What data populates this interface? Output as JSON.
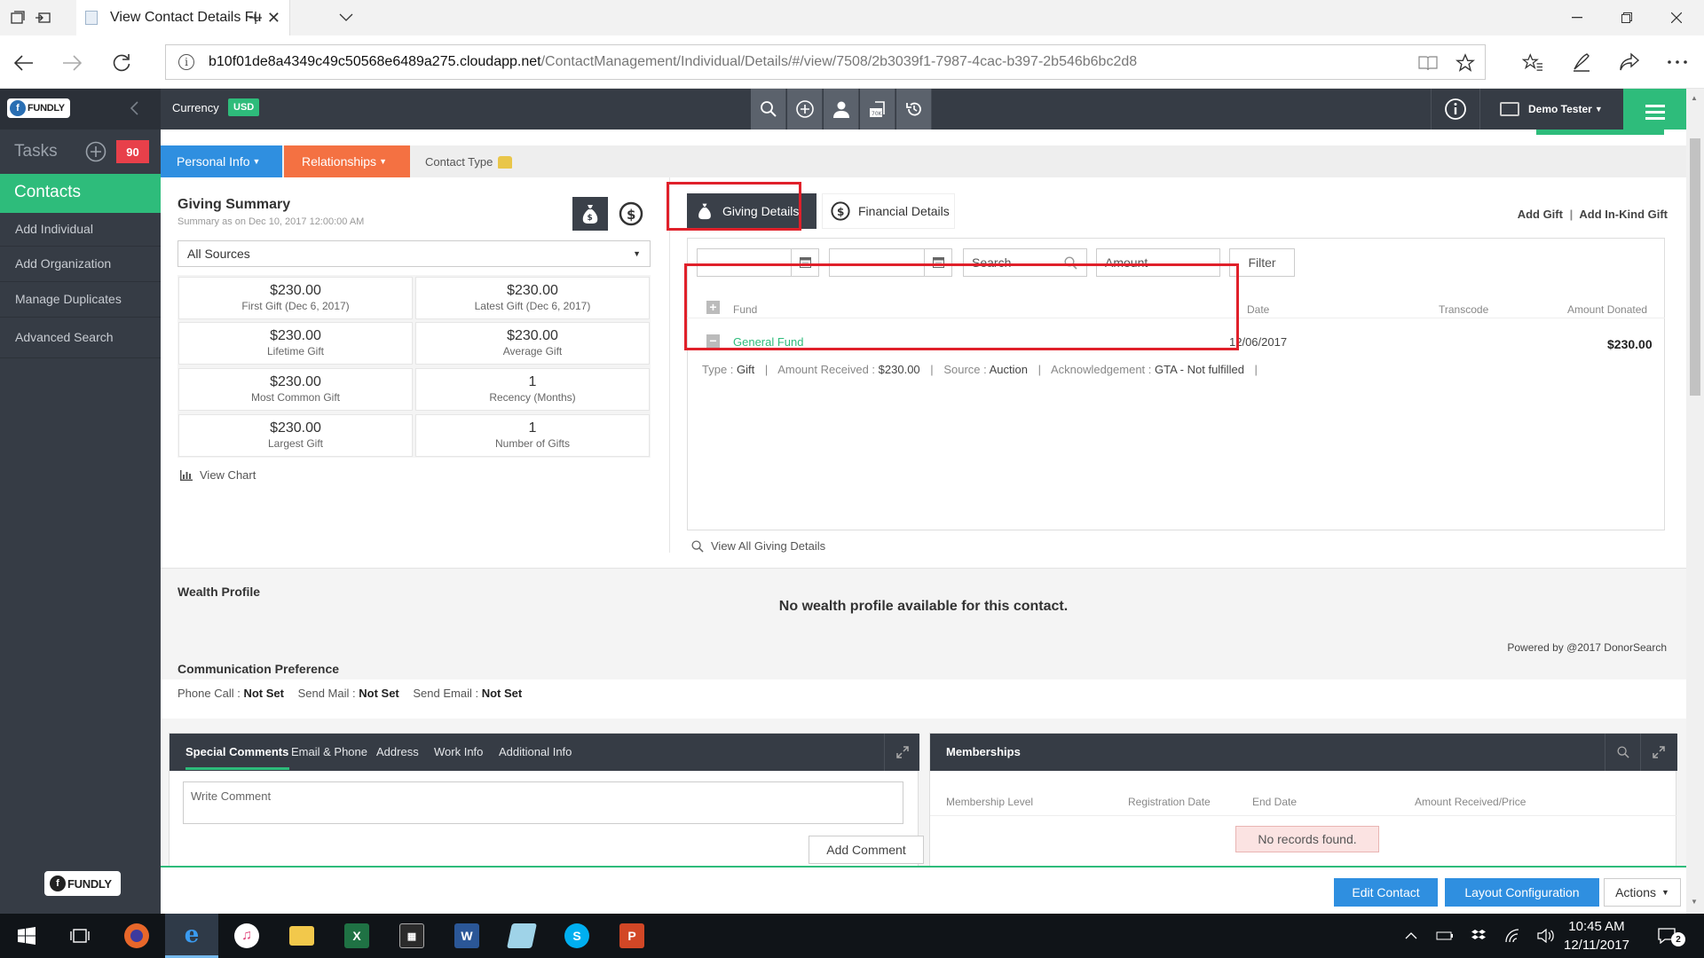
{
  "browser": {
    "tab_title": "View Contact Details Fu",
    "url_host": "b10f01de8a4349c49c50568e6489a275.cloudapp.net",
    "url_path": "/ContactManagement/Individual/Details/#/view/7508/2b3039f1-7987-4cac-b397-2b546b6bc2d8"
  },
  "topbar": {
    "logo_text": "FUNDLY",
    "currency_label": "Currency",
    "currency_value": "USD",
    "user_name": "Demo Tester",
    "tools": [
      "search-icon",
      "add-icon",
      "person-icon",
      "import-icon",
      "history-icon"
    ]
  },
  "sidebar": {
    "tasks_label": "Tasks",
    "tasks_count": "90",
    "contacts_label": "Contacts",
    "items": [
      {
        "label": "Add Individual"
      },
      {
        "label": "Add Organization"
      },
      {
        "label": "Manage Duplicates"
      },
      {
        "label": "Advanced Search"
      }
    ],
    "logo_text": "FUNDLY"
  },
  "subnav": {
    "personal_info": "Personal Info",
    "relationships": "Relationships",
    "contact_type": "Contact Type"
  },
  "giving_summary": {
    "title": "Giving Summary",
    "subtitle": "Summary as on Dec 10, 2017 12:00:00 AM",
    "source_select": "All Sources",
    "stats": [
      {
        "value": "$230.00",
        "label": "First Gift (Dec 6, 2017)"
      },
      {
        "value": "$230.00",
        "label": "Latest Gift (Dec 6, 2017)"
      },
      {
        "value": "$230.00",
        "label": "Lifetime Gift"
      },
      {
        "value": "$230.00",
        "label": "Average Gift"
      },
      {
        "value": "$230.00",
        "label": "Most Common Gift"
      },
      {
        "value": "1",
        "label": "Recency (Months)"
      },
      {
        "value": "$230.00",
        "label": "Largest Gift"
      },
      {
        "value": "1",
        "label": "Number of Gifts"
      }
    ],
    "view_chart": "View Chart"
  },
  "giving_details": {
    "tab_giving": "Giving Details",
    "tab_financial": "Financial Details",
    "add_gift": "Add Gift",
    "add_inkind": "Add In-Kind Gift",
    "search_placeholder": "Search",
    "amount_placeholder": "Amount",
    "filter_label": "Filter",
    "columns": {
      "fund": "Fund",
      "date": "Date",
      "transcode": "Transcode",
      "amount": "Amount Donated"
    },
    "gift": {
      "fund": "General Fund",
      "date": "12/06/2017",
      "amount": "$230.00",
      "type_label": "Type :",
      "type_value": "Gift",
      "received_label": "Amount Received :",
      "received_value": "$230.00",
      "source_label": "Source :",
      "source_value": "Auction",
      "ack_label": "Acknowledgement :",
      "ack_value": "GTA - Not fulfilled"
    },
    "view_all": "View All Giving Details"
  },
  "wealth": {
    "title": "Wealth Profile",
    "message": "No wealth profile available for this contact.",
    "powered": "Powered by @2017 DonorSearch"
  },
  "communication": {
    "title": "Communication Preference",
    "phone_label": "Phone Call :",
    "phone_value": "Not Set",
    "mail_label": "Send Mail :",
    "mail_value": "Not Set",
    "email_label": "Send Email :",
    "email_value": "Not Set"
  },
  "comments": {
    "tabs": [
      "Special Comments",
      "Email & Phone",
      "Address",
      "Work Info",
      "Additional Info"
    ],
    "placeholder": "Write Comment",
    "add_button": "Add Comment"
  },
  "memberships": {
    "title": "Memberships",
    "columns": [
      "Membership Level",
      "Registration Date",
      "End Date",
      "Amount Received/Price"
    ],
    "empty": "No records found."
  },
  "actions": {
    "edit_contact": "Edit Contact",
    "layout_config": "Layout Configuration",
    "actions": "Actions"
  },
  "taskbar": {
    "time": "10:45 AM",
    "date": "12/11/2017",
    "notifications": "2"
  },
  "colors": {
    "accent_green": "#2ebc7b",
    "blue": "#2f8fe0",
    "orange": "#f47142",
    "dark": "#363c45",
    "highlight_red": "#e0202a"
  }
}
